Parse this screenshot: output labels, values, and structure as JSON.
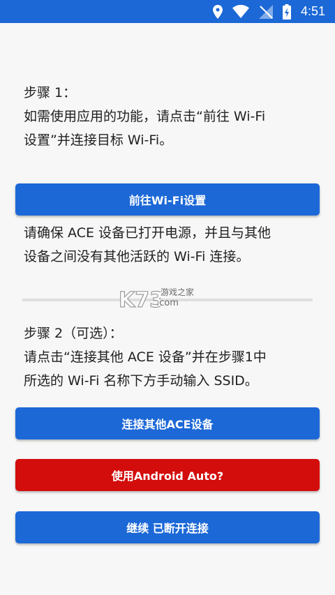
{
  "status_bar": {
    "time": "4:51",
    "icons": [
      "location-icon",
      "wifi-icon",
      "no-signal-icon",
      "battery-charging-icon"
    ],
    "background": "#1b68d6"
  },
  "step1": {
    "title": "步骤 1：",
    "line1": "如需使用应用的功能，请点击“前往 Wi-Fi",
    "line2": "设置”并连接目标 Wi-Fi。"
  },
  "wifi_settings_button": {
    "label": "前往Wi-Fi设置",
    "color": "#1c68d7"
  },
  "power_note": {
    "line1": "请确保 ACE 设备已打开电源，并且与其他",
    "line2": "设备之间没有其他活跃的 Wi-Fi 连接。"
  },
  "watermark": {
    "logo": "K73",
    "text": "游戏之家",
    "domain": ".com"
  },
  "step2": {
    "title": "步骤 2（可选）：",
    "line1": "请点击“连接其他 ACE 设备”并在步骤1中",
    "line2": "所选的 Wi-Fi 名称下方手动输入 SSID。"
  },
  "connect_other_button": {
    "label": "连接其他ACE设备",
    "color": "#1c68d7"
  },
  "android_auto_button": {
    "label": "使用Android Auto?",
    "color": "#d30c0c"
  },
  "continue_button": {
    "label": "继续 已断开连接",
    "color": "#1c68d7"
  }
}
